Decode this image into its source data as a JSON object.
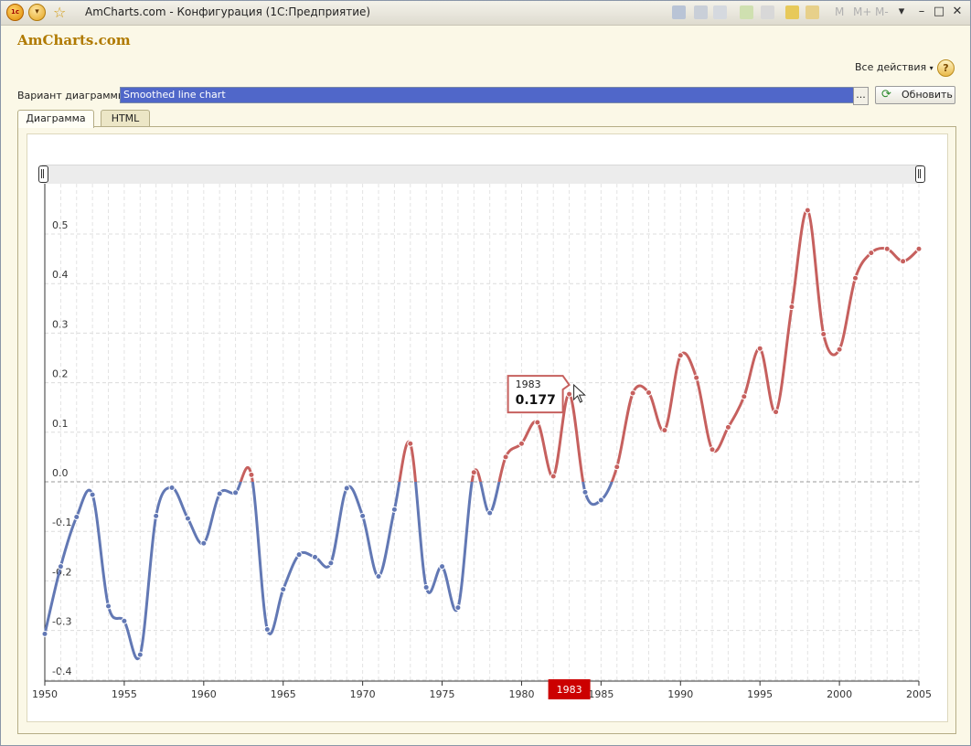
{
  "window": {
    "title": "AmCharts.com - Конфигурация  (1С:Предприятие)",
    "toolbar_text": [
      "M",
      "M+",
      "M-"
    ]
  },
  "app": {
    "title": "AmCharts.com"
  },
  "actions": {
    "all_actions": "Все действия",
    "help": "?"
  },
  "variant": {
    "label": "Вариант диаграммы:",
    "value": "Smoothed line chart",
    "dots": "...",
    "refresh": "Обновить"
  },
  "tabs": [
    {
      "label": "Диаграмма",
      "active": true
    },
    {
      "label": "HTML",
      "active": false
    }
  ],
  "colors": {
    "positive": "#c6605e",
    "negative": "#6278b4",
    "cursor": "#cc0000"
  },
  "tooltip": {
    "year": "1983",
    "value": "0.177"
  },
  "cursor_label": "1983",
  "chart_data": {
    "type": "line",
    "smoothed": true,
    "title": "",
    "xlabel": "",
    "ylabel": "",
    "xlim": [
      1950,
      2005
    ],
    "ylim": [
      -0.4,
      0.55
    ],
    "x_ticks": [
      "1950",
      "1955",
      "1960",
      "1965",
      "1970",
      "1975",
      "1980",
      "1985",
      "1990",
      "1995",
      "2000",
      "2005"
    ],
    "y_ticks": [
      "-0.4",
      "-0.3",
      "-0.2",
      "-0.1",
      "0.0",
      "0.1",
      "0.2",
      "0.3",
      "0.4",
      "0.5"
    ],
    "grid": true,
    "zero_line": true,
    "series": [
      {
        "x": [
          1950,
          1951,
          1952,
          1953,
          1954,
          1955,
          1956,
          1957,
          1958,
          1959,
          1960,
          1961,
          1962,
          1963,
          1964,
          1965,
          1966,
          1967,
          1968,
          1969,
          1970,
          1971,
          1972,
          1973,
          1974,
          1975,
          1976,
          1977,
          1978,
          1979,
          1980,
          1981,
          1982,
          1983,
          1984,
          1985,
          1986,
          1987,
          1988,
          1989,
          1990,
          1991,
          1992,
          1993,
          1994,
          1995,
          1996,
          1997,
          1998,
          1999,
          2000,
          2001,
          2002,
          2003,
          2004,
          2005
        ],
        "values": [
          -0.307,
          -0.171,
          -0.071,
          -0.026,
          -0.251,
          -0.281,
          -0.349,
          -0.069,
          -0.012,
          -0.074,
          -0.124,
          -0.024,
          -0.022,
          0.014,
          -0.298,
          -0.217,
          -0.147,
          -0.152,
          -0.164,
          -0.013,
          -0.069,
          -0.191,
          -0.056,
          0.077,
          -0.213,
          -0.171,
          -0.254,
          0.019,
          -0.063,
          0.05,
          0.077,
          0.12,
          0.011,
          0.177,
          -0.021,
          -0.037,
          0.03,
          0.179,
          0.18,
          0.104,
          0.255,
          0.21,
          0.065,
          0.11,
          0.172,
          0.269,
          0.141,
          0.353,
          0.548,
          0.298,
          0.267,
          0.411,
          0.462,
          0.47,
          0.445,
          0.47
        ]
      }
    ]
  }
}
